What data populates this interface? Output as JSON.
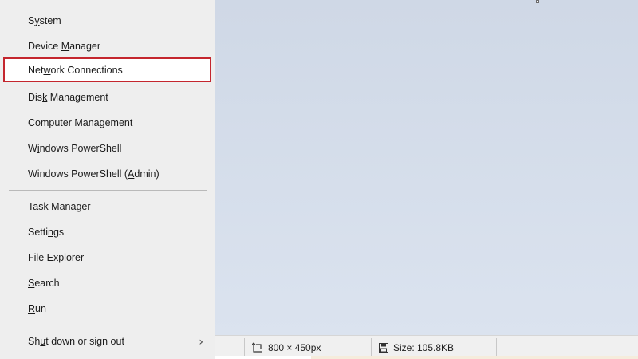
{
  "menu": {
    "groups": [
      [
        {
          "label": "System",
          "access": "y"
        },
        {
          "label": "Device Manager",
          "access": "M"
        },
        {
          "label": "Network Connections",
          "access": "w",
          "highlighted": true
        },
        {
          "label": "Disk Management",
          "access": "k"
        },
        {
          "label": "Computer Management",
          "access": "g"
        },
        {
          "label": "Windows PowerShell",
          "access": "i"
        },
        {
          "label": "Windows PowerShell (Admin)",
          "access": "A"
        }
      ],
      [
        {
          "label": "Task Manager",
          "access": "T"
        },
        {
          "label": "Settings",
          "access": "n"
        },
        {
          "label": "File Explorer",
          "access": "E"
        },
        {
          "label": "Search",
          "access": "S"
        },
        {
          "label": "Run",
          "access": "R"
        }
      ],
      [
        {
          "label": "Shut down or sign out",
          "access": "u",
          "submenu": true
        }
      ]
    ]
  },
  "statusbar": {
    "dimensions": "800 × 450px",
    "size": "Size: 105.8KB"
  },
  "colors": {
    "highlight_border": "#c4262e",
    "menu_bg": "#eeeeee",
    "canvas_bg": "#d3dbe8"
  },
  "icons": {
    "dimensions": "image-dimensions-icon",
    "size": "save-disk-icon",
    "submenu": "chevron-right-icon"
  }
}
